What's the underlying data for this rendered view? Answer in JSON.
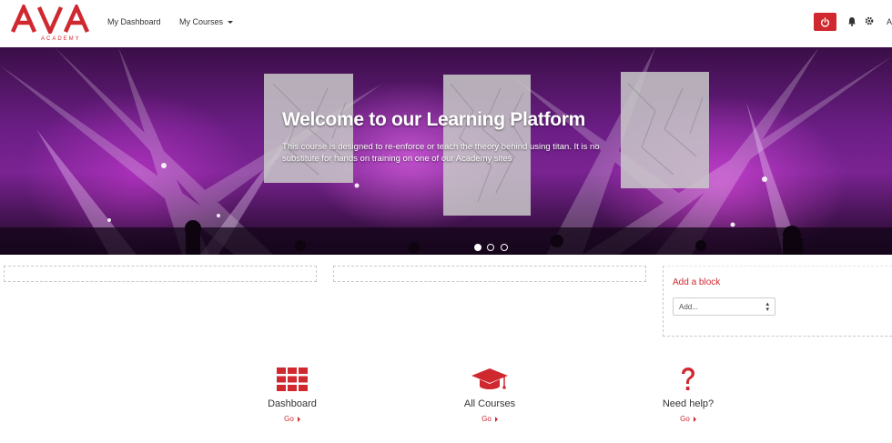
{
  "brand": {
    "logo_text": "AVA",
    "logo_subtext": "ACADEMY",
    "accent_color": "#d0282f"
  },
  "navbar": {
    "links": [
      {
        "label": "My Dashboard"
      },
      {
        "label": "My Courses"
      }
    ],
    "icons": [
      "power-icon",
      "bell-icon",
      "gear-icon"
    ],
    "user_initial": "A"
  },
  "hero": {
    "title": "Welcome to our Learning Platform",
    "text": "This course is designed to re-enforce or teach the theory behind using titan. It is no substitute for hands on training on one of our Academy sites",
    "slides": 3,
    "active_slide": 1
  },
  "add_block": {
    "title": "Add a block",
    "select_value": "Add..."
  },
  "quick_links": [
    {
      "icon": "grid-icon",
      "label": "Dashboard",
      "action": "Go"
    },
    {
      "icon": "graduation-cap-icon",
      "label": "All Courses",
      "action": "Go"
    },
    {
      "icon": "question-mark-icon",
      "label": "Need help?",
      "action": "Go"
    }
  ]
}
